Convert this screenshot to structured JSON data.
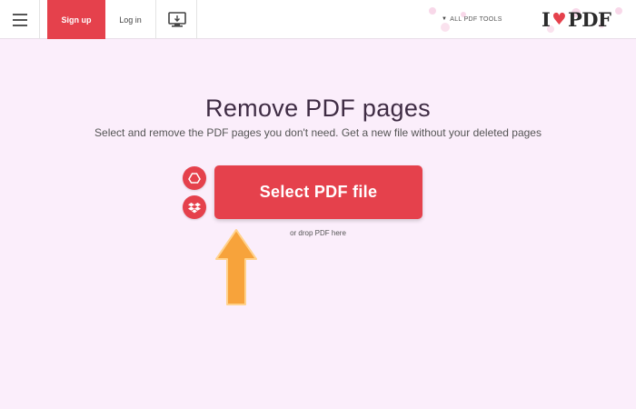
{
  "header": {
    "logo": {
      "left": "I",
      "right": "PDF",
      "heart": "♥"
    },
    "tools_menu_label": "ALL PDF TOOLS",
    "login_label": "Log in",
    "signup_label": "Sign up"
  },
  "main": {
    "title": "Remove PDF pages",
    "subtitle": "Select and remove the PDF pages you don't need. Get a new file without your deleted pages",
    "select_button_label": "Select PDF file",
    "drop_hint": "or drop PDF here"
  },
  "colors": {
    "accent": "#e5414c",
    "background": "#fbeefb",
    "arrow": "#f7a33b"
  }
}
